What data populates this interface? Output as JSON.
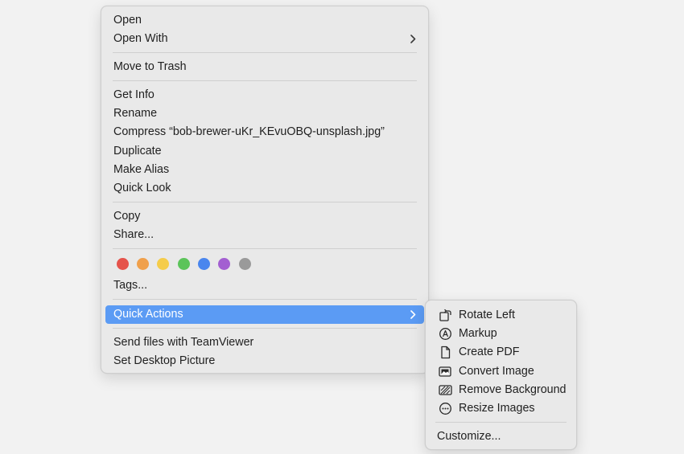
{
  "context_menu": {
    "items": {
      "open": "Open",
      "open_with": "Open With",
      "move_to_trash": "Move to Trash",
      "get_info": "Get Info",
      "rename": "Rename",
      "compress": "Compress “bob-brewer-uKr_KEvuOBQ-unsplash.jpg”",
      "duplicate": "Duplicate",
      "make_alias": "Make Alias",
      "quick_look": "Quick Look",
      "copy": "Copy",
      "share": "Share...",
      "tags": "Tags...",
      "quick_actions": "Quick Actions",
      "send_teamviewer": "Send files with TeamViewer",
      "set_desktop_picture": "Set Desktop Picture"
    },
    "tag_colors": [
      {
        "name": "red",
        "color": "#e5534b"
      },
      {
        "name": "orange",
        "color": "#f0a04b"
      },
      {
        "name": "yellow",
        "color": "#f5cc4a"
      },
      {
        "name": "green",
        "color": "#5cc45a"
      },
      {
        "name": "blue",
        "color": "#4a86ee"
      },
      {
        "name": "purple",
        "color": "#a35fd1"
      },
      {
        "name": "gray",
        "color": "#9a9a9a"
      }
    ],
    "highlight_color": "#5b9bf4"
  },
  "quick_actions_submenu": {
    "items": [
      {
        "label": "Rotate Left",
        "icon": "rotate-left-icon"
      },
      {
        "label": "Markup",
        "icon": "markup-icon"
      },
      {
        "label": "Create PDF",
        "icon": "create-pdf-icon"
      },
      {
        "label": "Convert Image",
        "icon": "convert-image-icon"
      },
      {
        "label": "Remove Background",
        "icon": "remove-background-icon"
      },
      {
        "label": "Resize Images",
        "icon": "resize-images-icon"
      }
    ],
    "customize": "Customize..."
  }
}
